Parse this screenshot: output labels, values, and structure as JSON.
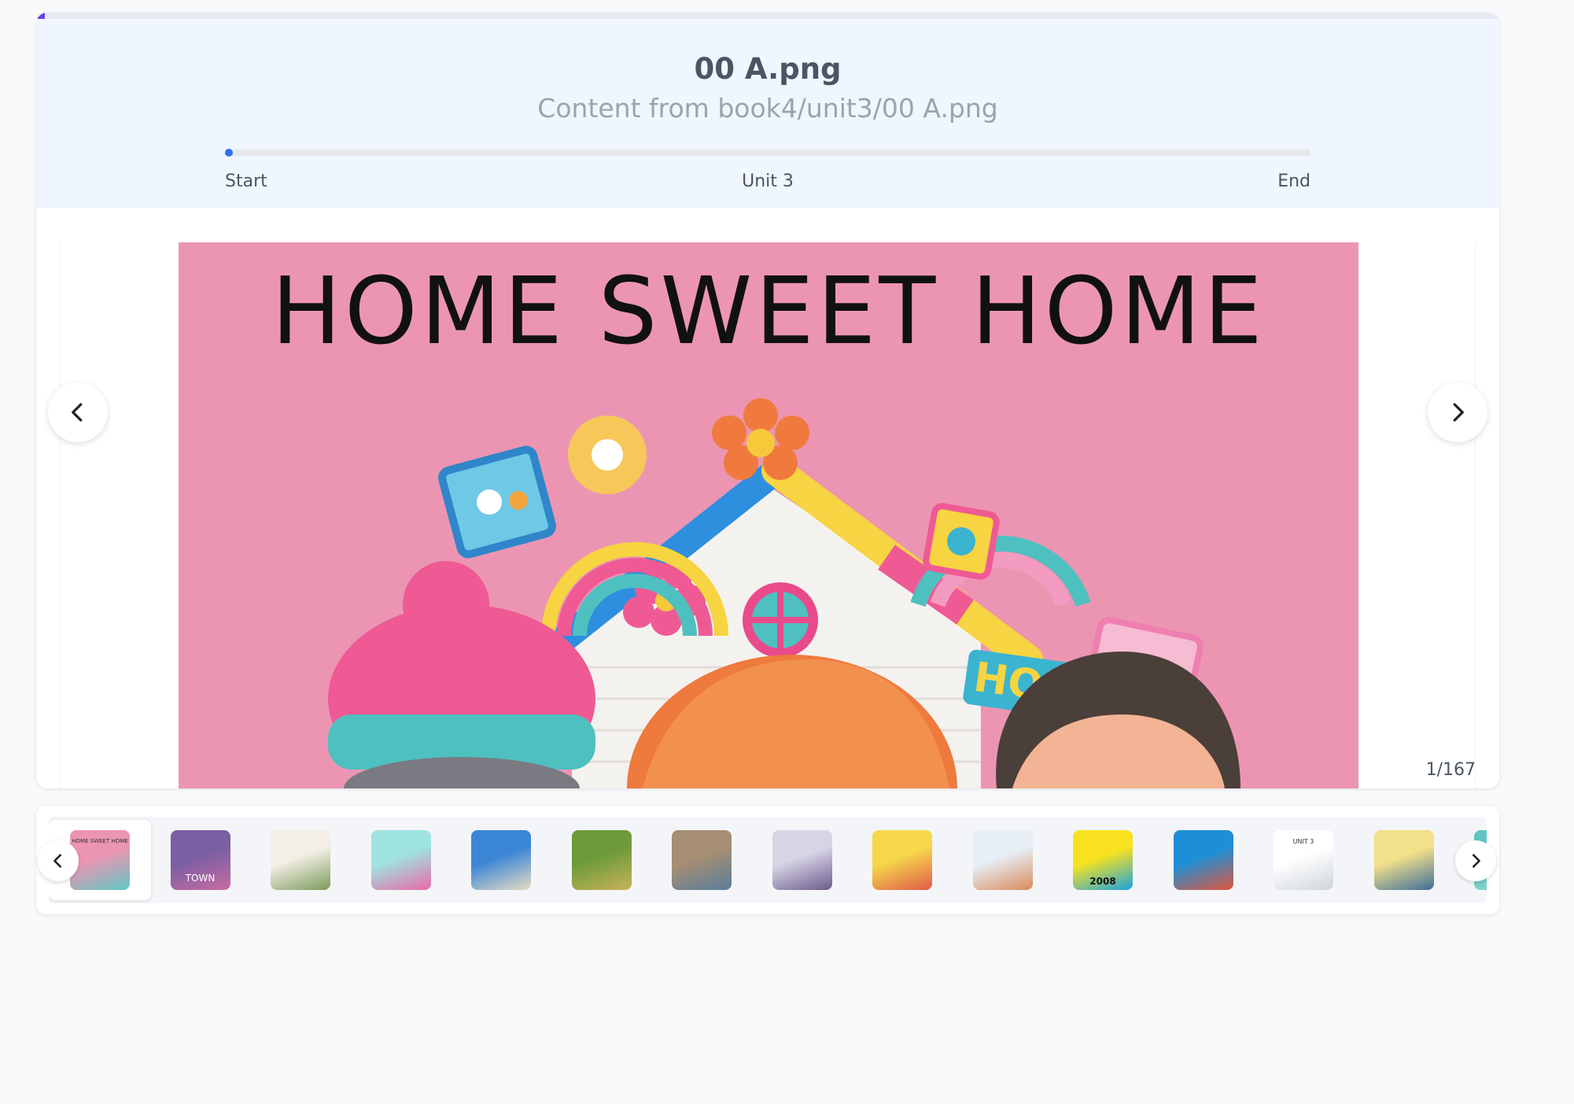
{
  "header": {
    "title": "00 A.png",
    "subtitle": "Content from book4/unit3/00 A.png",
    "progress": {
      "start_label": "Start",
      "middle_label": "Unit 3",
      "end_label": "End",
      "position_fraction": 0.0
    },
    "top_progress_fraction": 0.006
  },
  "viewer": {
    "slide_title": "HOME SWEET HOME",
    "counter": "1/167",
    "prev_icon": "chevron-left-icon",
    "next_icon": "chevron-right-icon",
    "slide_background": "#ec95b2",
    "sign_text": "HOME"
  },
  "thumbnails": {
    "items": [
      {
        "name": "thumb-1",
        "caption": "HOME SWEET HOME",
        "colors": [
          "#ec95b2",
          "#5fc7c3"
        ],
        "active": true
      },
      {
        "name": "thumb-2",
        "caption": "TOWN",
        "colors": [
          "#7b5fa3",
          "#c86ba2"
        ],
        "active": false
      },
      {
        "name": "thumb-3",
        "caption": "",
        "colors": [
          "#f3efe6",
          "#7c9a5a"
        ],
        "active": false
      },
      {
        "name": "thumb-4",
        "caption": "",
        "colors": [
          "#9fe3e0",
          "#e86aa8"
        ],
        "active": false
      },
      {
        "name": "thumb-5",
        "caption": "",
        "colors": [
          "#3c86d6",
          "#e7dcc3"
        ],
        "active": false
      },
      {
        "name": "thumb-6",
        "caption": "",
        "colors": [
          "#6e9b3a",
          "#c9b25a"
        ],
        "active": false
      },
      {
        "name": "thumb-7",
        "caption": "",
        "colors": [
          "#a68e72",
          "#5a7e9a"
        ],
        "active": false
      },
      {
        "name": "thumb-8",
        "caption": "",
        "colors": [
          "#d8d4e6",
          "#6a5a8a"
        ],
        "active": false
      },
      {
        "name": "thumb-9",
        "caption": "",
        "colors": [
          "#f6d74a",
          "#e05a4a"
        ],
        "active": false
      },
      {
        "name": "thumb-10",
        "caption": "",
        "colors": [
          "#e7eef6",
          "#d98a5a"
        ],
        "active": false
      },
      {
        "name": "thumb-11",
        "caption": "2008",
        "colors": [
          "#f8e21f",
          "#1aa3e0"
        ],
        "active": false
      },
      {
        "name": "thumb-12",
        "caption": "",
        "colors": [
          "#1e8fd6",
          "#e0563c"
        ],
        "active": false
      },
      {
        "name": "thumb-13",
        "caption": "UNIT 3",
        "colors": [
          "#ffffff",
          "#cfd5dc"
        ],
        "active": false
      },
      {
        "name": "thumb-14",
        "caption": "",
        "colors": [
          "#f2e08a",
          "#3c6e9a"
        ],
        "active": false
      },
      {
        "name": "thumb-15",
        "caption": "",
        "colors": [
          "#5fc7c3",
          "#a0d8d0"
        ],
        "active": false
      }
    ],
    "prev_icon": "chevron-left-icon",
    "next_icon": "chevron-right-icon"
  }
}
